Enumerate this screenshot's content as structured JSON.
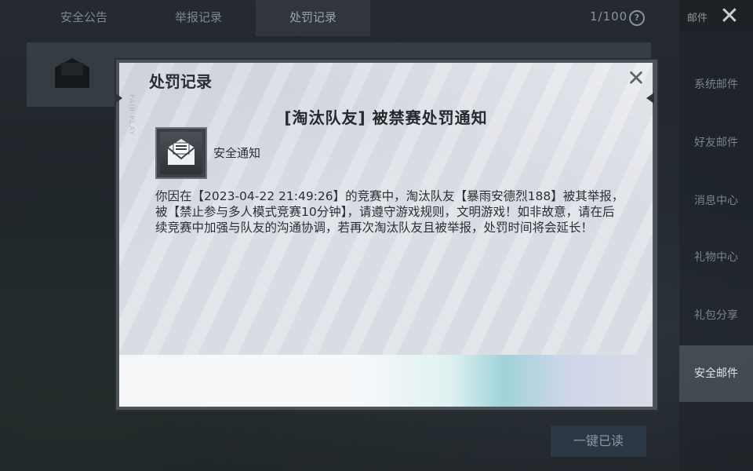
{
  "top_tabs": [
    {
      "label": "安全公告",
      "active": false
    },
    {
      "label": "举报记录",
      "active": false
    },
    {
      "label": "处罚记录",
      "active": true
    }
  ],
  "mail_count": "1/100",
  "help_glyph": "?",
  "sidebar": {
    "header_label": "邮件",
    "close_glyph": "✕",
    "items": [
      {
        "label": "系统邮件",
        "active": false
      },
      {
        "label": "好友邮件",
        "active": false
      },
      {
        "label": "消息中心",
        "active": false
      },
      {
        "label": "礼物中心",
        "active": false
      },
      {
        "label": "礼包分享",
        "active": false
      },
      {
        "label": "安全邮件",
        "active": true
      }
    ]
  },
  "read_all_button": "一键已读",
  "modal": {
    "title": "处罚记录",
    "close_glyph": "✕",
    "watermark": "FAIR PLAY",
    "notice_title": "[淘汰队友] 被禁赛处罚通知",
    "sender_icon": "envelope-icon",
    "sender_name": "安全通知",
    "body": "你因在【2023-04-22 21:49:26】的竞赛中，淘汰队友【暴雨安德烈188】被其举报，被【禁止参与多人模式竞赛10分钟】，请遵守游戏规则，文明游戏！如非故意，请在后续竞赛中加强与队友的沟通协调，若再次淘汰队友且被举报，处罚时间将会延长！"
  },
  "colors": {
    "active_sidebar": "#6e7880",
    "modal_panel": "#dcdfe6",
    "modal_frame": "#4d5358"
  }
}
